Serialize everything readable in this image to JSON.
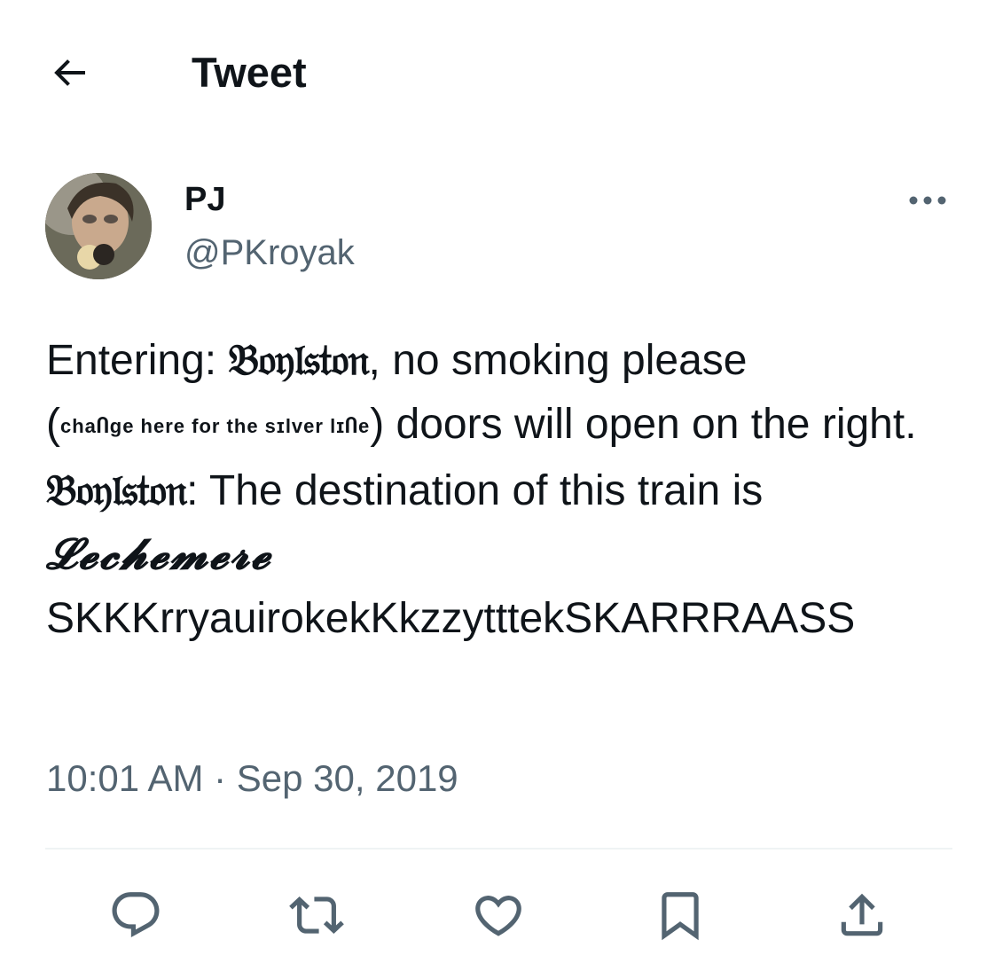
{
  "header": {
    "title": "Tweet",
    "back_icon": "arrow-left-icon"
  },
  "author": {
    "display_name": "PJ",
    "handle": "@PKroyak",
    "more_icon": "more-horizontal-icon"
  },
  "tweet": {
    "line1_prefix": "Entering: ",
    "line1_station": "𝔅𝔬𝔶𝔩𝔰𝔱𝔬𝔫",
    "line1_suffix": ", no smoking please",
    "note_open": "(",
    "note_text": "chaႶge here for the sɪlver lɪႶe",
    "note_close": ")",
    "line2_suffix": " doors will open on the right.",
    "line3_station": "𝔅𝔬𝔶𝔩𝔰𝔱𝔬𝔫",
    "line3_suffix": ": The destination of this train is",
    "destination": "𝓛𝓮𝓬𝓱𝓮𝓶𝓮𝓻𝓮",
    "noise": " SKKKrryauirokekKkzzytttekSKARRRAASS"
  },
  "timestamp": "10:01 AM · Sep 30, 2019",
  "actions": [
    {
      "name": "reply",
      "icon": "reply-icon"
    },
    {
      "name": "retweet",
      "icon": "retweet-icon"
    },
    {
      "name": "like",
      "icon": "heart-icon"
    },
    {
      "name": "bookmark",
      "icon": "bookmark-icon"
    },
    {
      "name": "share",
      "icon": "share-icon"
    }
  ],
  "colors": {
    "text": "#0f1419",
    "secondary": "#536471",
    "divider": "#eff3f4"
  }
}
